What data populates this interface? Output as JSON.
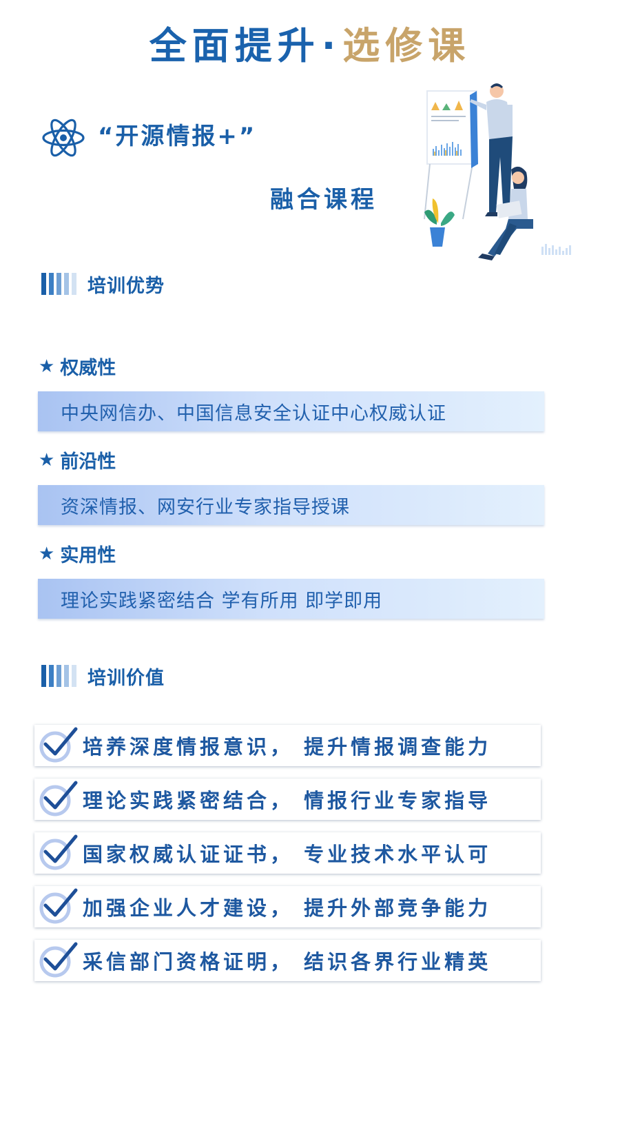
{
  "header": {
    "title_main": "全面提升",
    "title_dot": "·",
    "title_accent": "选修课",
    "icon": "atom-icon"
  },
  "course": {
    "name": "“开源情报+”",
    "subtitle": "融合课程"
  },
  "advantages": {
    "heading": "培训优势",
    "items": [
      {
        "title": "权威性",
        "desc": "中央网信办、中国信息安全认证中心权威认证"
      },
      {
        "title": "前沿性",
        "desc": "资深情报、网安行业专家指导授课"
      },
      {
        "title": "实用性",
        "desc": "理论实践紧密结合 学有所用 即学即用"
      }
    ]
  },
  "values": {
    "heading": "培训价值",
    "items": [
      "培养深度情报意识， 提升情报调查能力",
      "理论实践紧密结合， 情报行业专家指导",
      "国家权威认证证书， 专业技术水平认可",
      "加强企业人才建设， 提升外部竞争能力",
      "采信部门资格证明， 结识各界行业精英"
    ]
  },
  "colors": {
    "primary": "#1a5fa8",
    "accent_gold": "#c8a46a",
    "box_gradient_start": "#a9c3f2",
    "box_gradient_end": "#e3f0fd"
  }
}
